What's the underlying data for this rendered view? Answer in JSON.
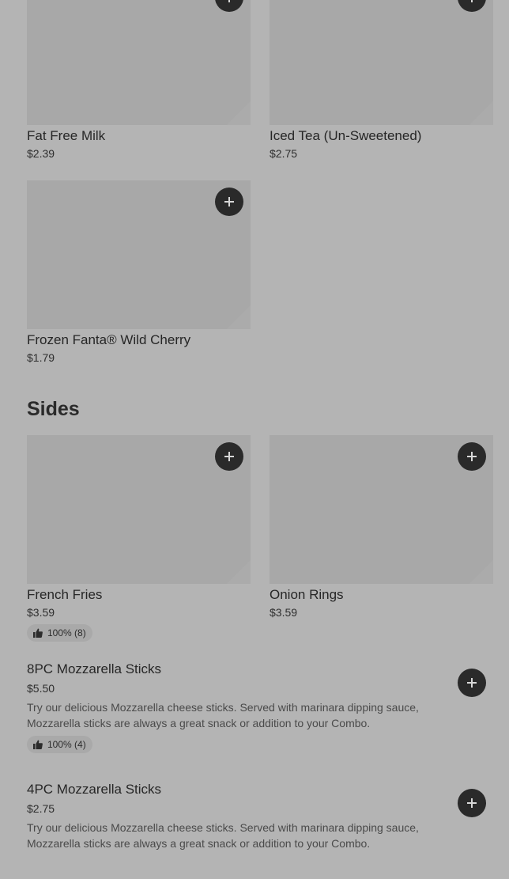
{
  "drinks": [
    {
      "name": "Fat Free Milk",
      "price": "$2.39"
    },
    {
      "name": "Iced Tea (Un-Sweetened)",
      "price": "$2.75"
    },
    {
      "name": "Frozen Fanta® Wild Cherry",
      "price": "$1.79"
    }
  ],
  "sides": {
    "title": "Sides",
    "cards": [
      {
        "name": "French Fries",
        "price": "$3.59",
        "rating": "100% (8)"
      },
      {
        "name": "Onion Rings",
        "price": "$3.59"
      }
    ],
    "rows": [
      {
        "name": "8PC Mozzarella Sticks",
        "price": "$5.50",
        "description": "Try our delicious Mozzarella cheese sticks. Served with marinara dipping sauce, Mozzarella sticks are always a great snack or addition to your Combo.",
        "rating": "100% (4)"
      },
      {
        "name": "4PC Mozzarella Sticks",
        "price": "$2.75",
        "description": "Try our delicious Mozzarella cheese sticks. Served with marinara dipping sauce, Mozzarella sticks are always a great snack or addition to your Combo."
      }
    ]
  },
  "icons": {
    "add": "plus-icon",
    "rating": "thumbs-up-icon"
  }
}
